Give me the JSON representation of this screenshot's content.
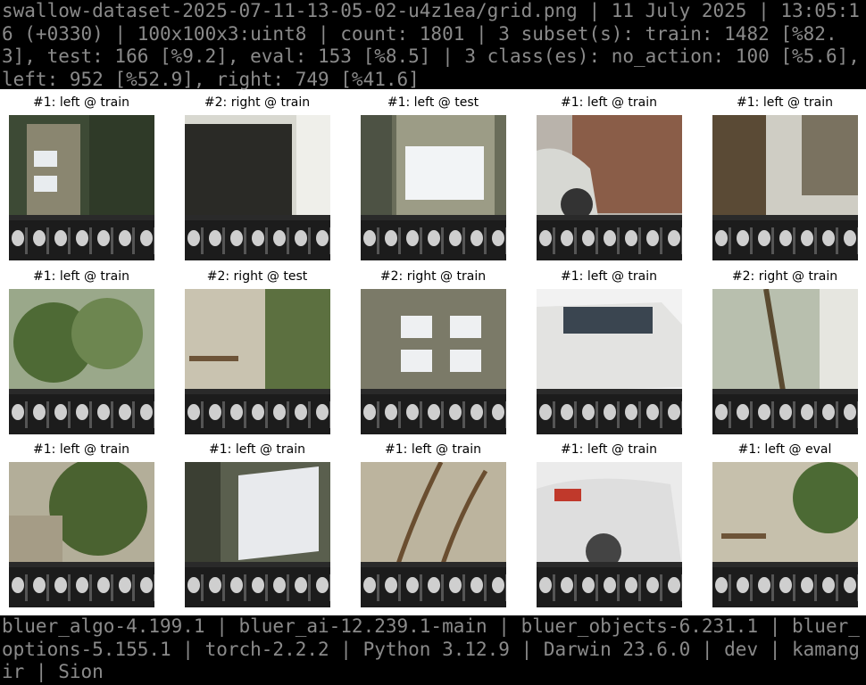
{
  "header": {
    "text": "swallow-dataset-2025-07-11-13-05-02-u4z1ea/grid.png | 11 July 2025 | 13:05:16 (+0330) | 100x100x3:uint8 | count: 1801 | 3 subset(s): train: 1482 [%82.3], test: 166 [%9.2], eval: 153 [%8.5] | 3 class(es): no_action: 100 [%5.6], left: 952 [%52.9], right: 749 [%41.6]"
  },
  "footer": {
    "text": "bluer_algo-4.199.1 | bluer_ai-12.239.1-main | bluer_objects-6.231.1 | bluer_options-5.155.1 | torch-2.2.2 | Python 3.12.9 | Darwin 23.6.0 | dev | kamangir | Sion"
  },
  "grid": {
    "cells": [
      {
        "caption": "#1: left @ train",
        "scene": "door"
      },
      {
        "caption": "#2: right @ train",
        "scene": "garage"
      },
      {
        "caption": "#1: left @ test",
        "scene": "window-door"
      },
      {
        "caption": "#1: left @ train",
        "scene": "car-brick"
      },
      {
        "caption": "#1: left @ train",
        "scene": "building-corner"
      },
      {
        "caption": "#1: left @ train",
        "scene": "plants"
      },
      {
        "caption": "#2: right @ test",
        "scene": "wall-ladder"
      },
      {
        "caption": "#2: right @ train",
        "scene": "double-door"
      },
      {
        "caption": "#1: left @ train",
        "scene": "car-white"
      },
      {
        "caption": "#2: right @ train",
        "scene": "wall-vines"
      },
      {
        "caption": "#1: left @ train",
        "scene": "tree"
      },
      {
        "caption": "#1: left @ train",
        "scene": "window-dark"
      },
      {
        "caption": "#1: left @ train",
        "scene": "wall-branches"
      },
      {
        "caption": "#1: left @ train",
        "scene": "car-rear"
      },
      {
        "caption": "#1: left @ eval",
        "scene": "wall-plants"
      }
    ]
  }
}
